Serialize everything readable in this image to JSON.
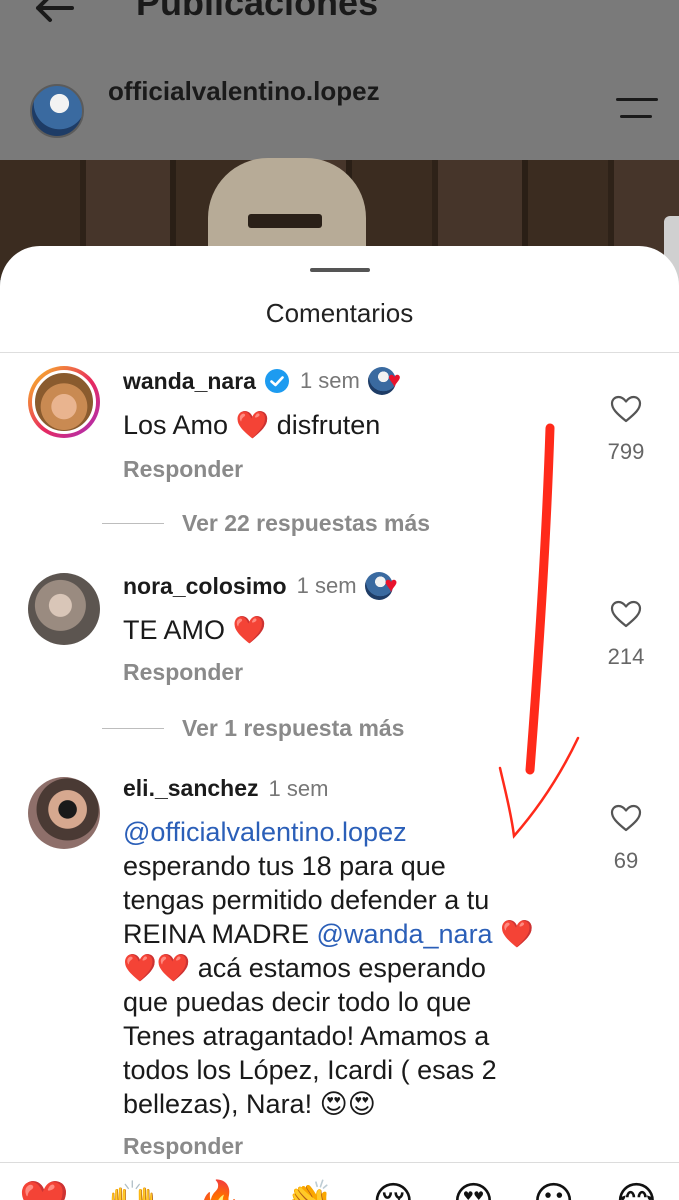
{
  "app": {
    "title": "Publicaciones",
    "username": "officialvalentino.lopez"
  },
  "sheet": {
    "title": "Comentarios"
  },
  "comments": [
    {
      "user": "wanda_nara",
      "verified": true,
      "time": "1 sem",
      "creator_liked": true,
      "text_parts": [
        "Los Amo ",
        "❤️",
        " disfruten"
      ],
      "likes": "799",
      "reply_label": "Responder",
      "more_replies": "Ver 22 respuestas más"
    },
    {
      "user": "nora_colosimo",
      "verified": false,
      "time": "1 sem",
      "creator_liked": true,
      "text_parts": [
        "TE AMO ",
        "❤️"
      ],
      "likes": "214",
      "reply_label": "Responder",
      "more_replies": "Ver 1 respuesta más"
    },
    {
      "user": "eli._sanchez",
      "verified": false,
      "time": "1 sem",
      "creator_liked": false,
      "mention1": "@officialvalentino.lopez",
      "line1": "esperando tus 18 para que",
      "line2": "tengas permitido defender a tu",
      "line3_pre": "REINA MADRE ",
      "mention2": "@wanda_nara",
      "line3_heart": " ❤️",
      "line4_hearts": "❤️❤️",
      "line4_text": " acá estamos esperando",
      "line5": "que puedas decir todo lo que",
      "line6": "Tenes atragantado! Amamos a",
      "line7": "todos los López, Icardi ( esas 2",
      "line8": "bellezas), Nara! 😍😍",
      "likes": "69",
      "reply_label": "Responder"
    }
  ],
  "emoji_bar": [
    "❤️",
    "🙌",
    "🔥",
    "👏",
    "😢",
    "😍",
    "😮",
    "😂"
  ],
  "colors": {
    "annotation": "#ff2a1a",
    "mention": "#2b5fb8",
    "verified": "#1d9bf0"
  }
}
